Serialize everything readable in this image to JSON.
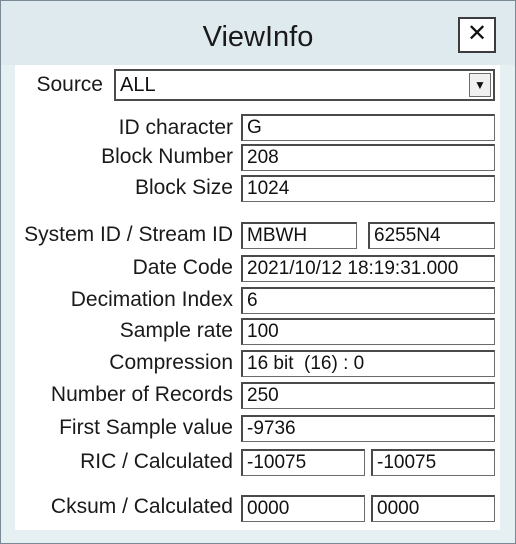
{
  "window": {
    "title": "ViewInfo",
    "close_label": "✕"
  },
  "source": {
    "label": "Source",
    "value": "ALL",
    "arrow": "▼"
  },
  "fields": {
    "id_character": {
      "label": "ID character",
      "value": "G"
    },
    "block_number": {
      "label": "Block Number",
      "value": "208"
    },
    "block_size": {
      "label": "Block Size",
      "value": "1024"
    },
    "system_stream": {
      "label": "System ID / Stream ID",
      "value1": "MBWH",
      "value2": "6255N4"
    },
    "date_code": {
      "label": "Date Code",
      "value": "2021/10/12 18:19:31.000"
    },
    "decimation_index": {
      "label": "Decimation Index",
      "value": "6"
    },
    "sample_rate": {
      "label": "Sample rate",
      "value": "100"
    },
    "compression": {
      "label": "Compression",
      "value": "16 bit  (16) : 0"
    },
    "number_of_records": {
      "label": "Number of Records",
      "value": "250"
    },
    "first_sample_value": {
      "label": "First Sample value",
      "value": "-9736"
    },
    "ric_calculated": {
      "label": "RIC / Calculated",
      "value1": "-10075",
      "value2": "-10075"
    },
    "cksum_calculated": {
      "label": "Cksum / Calculated",
      "value1": "0000",
      "value2": "0000"
    }
  }
}
